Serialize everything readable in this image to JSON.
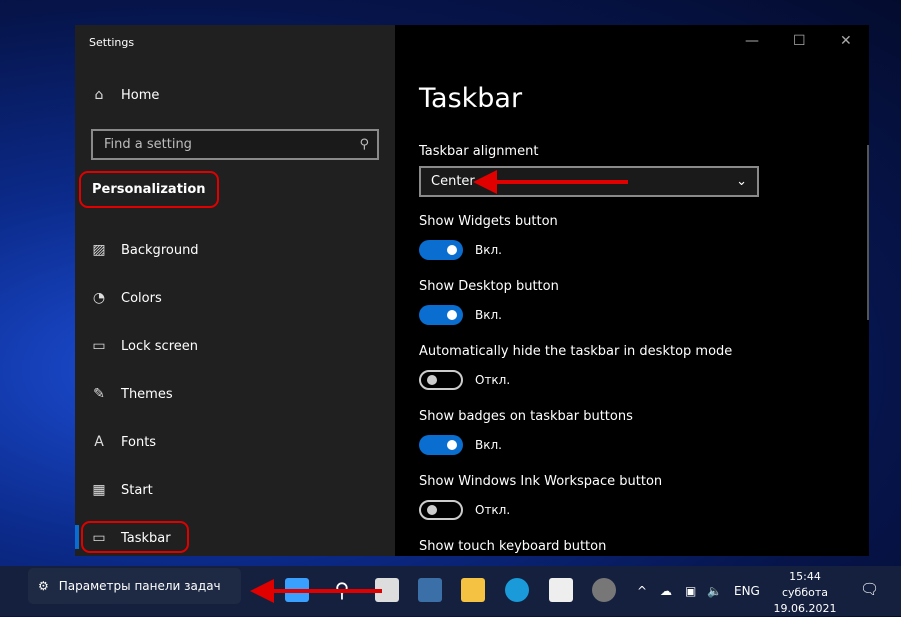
{
  "window": {
    "title": "Settings",
    "controls": [
      "—",
      "☐",
      "✕"
    ]
  },
  "sidebar": {
    "home": "Home",
    "search_placeholder": "Find a setting",
    "section": "Personalization",
    "items": [
      {
        "label": "Background",
        "icon": "▨"
      },
      {
        "label": "Colors",
        "icon": "◔"
      },
      {
        "label": "Lock screen",
        "icon": "▭"
      },
      {
        "label": "Themes",
        "icon": "✎"
      },
      {
        "label": "Fonts",
        "icon": "A"
      },
      {
        "label": "Start",
        "icon": "▦"
      },
      {
        "label": "Taskbar",
        "icon": "▭"
      }
    ],
    "selected": "Taskbar"
  },
  "main": {
    "title": "Taskbar",
    "alignment_label": "Taskbar alignment",
    "alignment_value": "Center",
    "toggles": [
      {
        "label": "Show Widgets button",
        "state": "Вкл.",
        "on": true
      },
      {
        "label": "Show Desktop button",
        "state": "Вкл.",
        "on": true
      },
      {
        "label": "Automatically hide the taskbar in desktop mode",
        "state": "Откл.",
        "on": false
      },
      {
        "label": "Show badges on taskbar buttons",
        "state": "Вкл.",
        "on": true
      },
      {
        "label": "Show Windows Ink Workspace button",
        "state": "Откл.",
        "on": false
      }
    ],
    "last_label": "Show touch keyboard button"
  },
  "taskbar": {
    "tooltip": "Параметры панели задач",
    "lang": "ENG",
    "time": "15:44",
    "day": "суббота",
    "date": "19.06.2021"
  },
  "colors": {
    "accent": "#0a6ed1",
    "annotation": "#e00000"
  }
}
